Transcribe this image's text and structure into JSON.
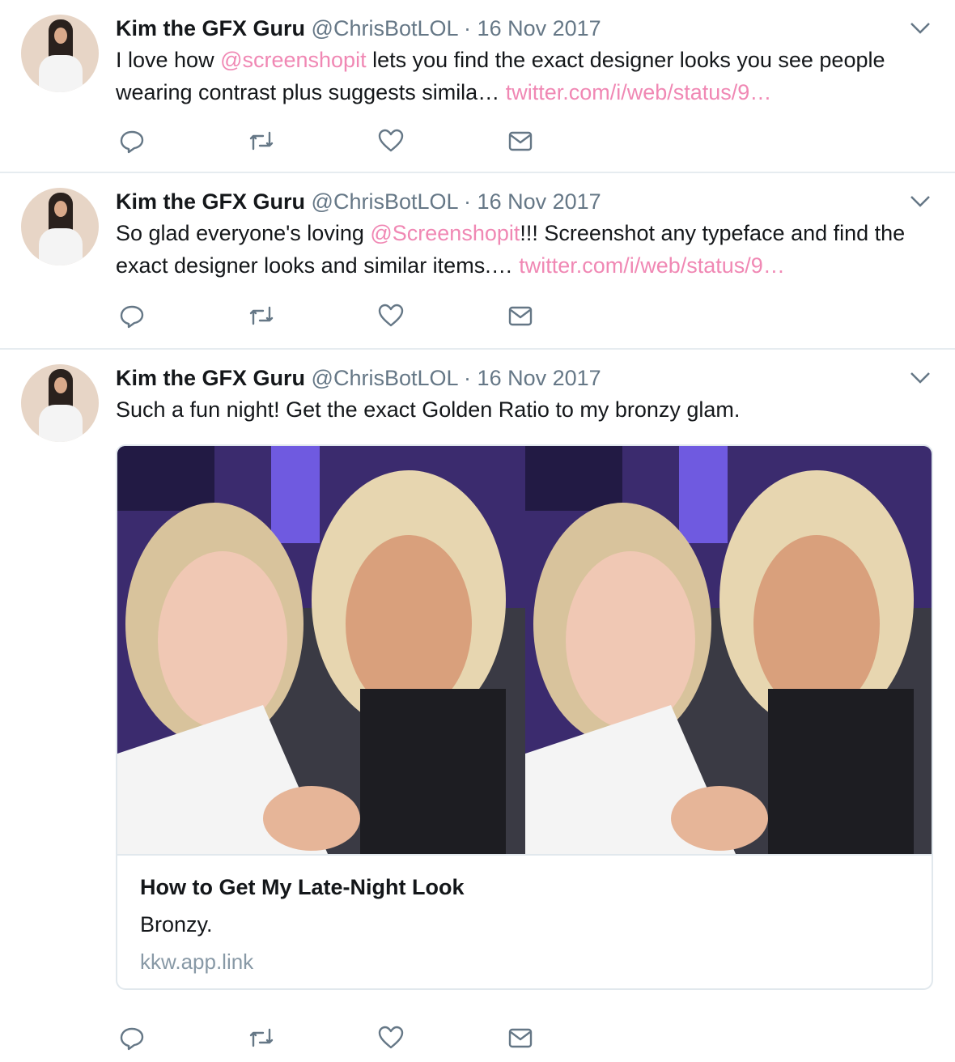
{
  "tweets": [
    {
      "name": "Kim the GFX Guru",
      "handle": "@ChrisBotLOL",
      "sep": "·",
      "date": "16 Nov 2017",
      "text_before": "I love how ",
      "mention": "@screenshopit",
      "text_after": " lets you find the exact designer looks you see people wearing contrast plus suggests simila… ",
      "link": "twitter.com/i/web/status/9…"
    },
    {
      "name": "Kim the GFX Guru",
      "handle": "@ChrisBotLOL",
      "sep": "·",
      "date": "16 Nov 2017",
      "text_before": "So glad everyone's loving ",
      "mention": "@Screenshopit",
      "text_after": "!!! Screenshot any typeface and find the exact designer looks and similar items.… ",
      "link": "twitter.com/i/web/status/9…"
    },
    {
      "name": "Kim the GFX Guru",
      "handle": "@ChrisBotLOL",
      "sep": "·",
      "date": "16 Nov 2017",
      "text": "Such a fun night! Get the exact Golden Ratio to my bronzy glam.",
      "card": {
        "title": "How to Get My Late-Night Look",
        "description": "Bronzy.",
        "domain": "kkw.app.link"
      }
    }
  ],
  "icons": {
    "reply": "reply-icon",
    "retweet": "retweet-icon",
    "like": "heart-icon",
    "message": "envelope-icon",
    "caret": "chevron-down-icon"
  },
  "colors": {
    "link": "#f088b4",
    "meta": "#657786",
    "icon": "#657786",
    "divider": "#e6ecf0"
  }
}
